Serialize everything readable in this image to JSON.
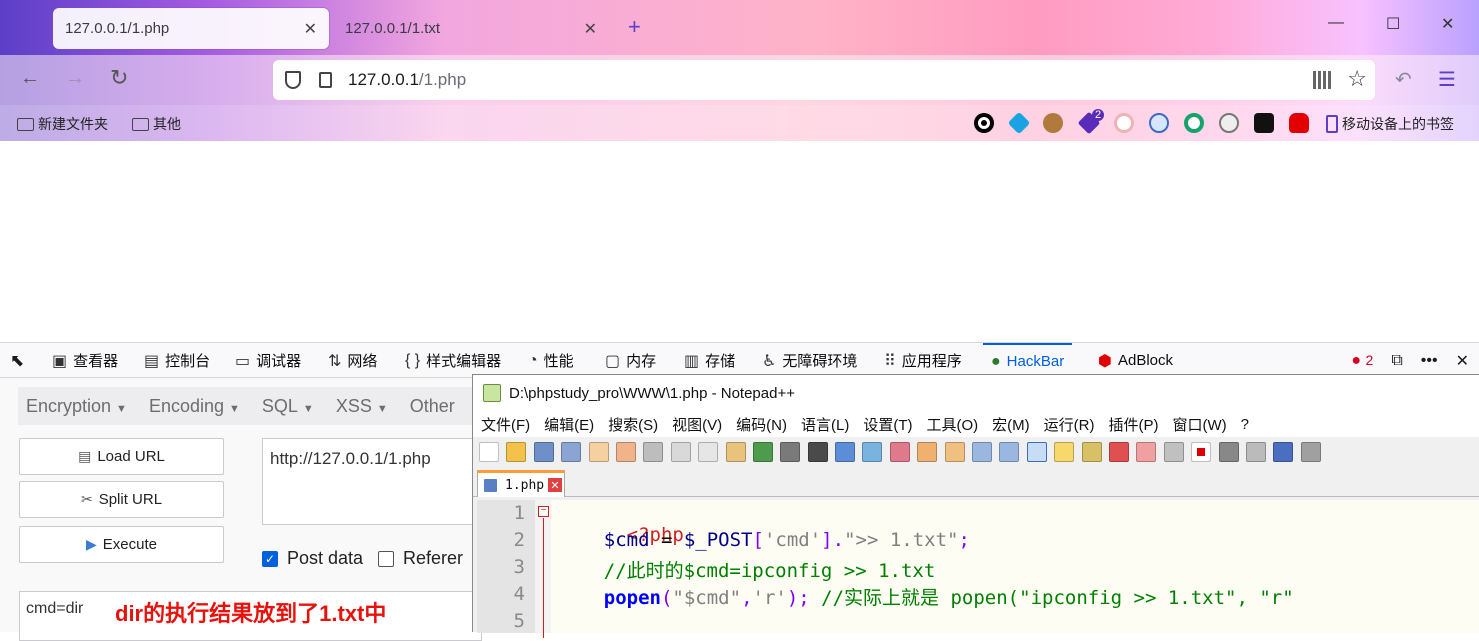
{
  "browser": {
    "tabs": [
      {
        "label": "127.0.0.1/1.php",
        "active": true
      },
      {
        "label": "127.0.0.1/1.txt",
        "active": false
      }
    ],
    "new_tab": "+",
    "window_controls": {
      "minimize": "—",
      "maximize": "☐",
      "close": "✕"
    },
    "url_host": "127.0.0.1",
    "url_path": "/1.php",
    "bookmarks": [
      "新建文件夹",
      "其他"
    ],
    "mobile_bookmarks": "移动设备上的书签",
    "extension_badge": "2"
  },
  "devtools": {
    "tabs": [
      {
        "icon": "inspector-icon",
        "label": "查看器"
      },
      {
        "icon": "console-icon",
        "label": "控制台"
      },
      {
        "icon": "debugger-icon",
        "label": "调试器"
      },
      {
        "icon": "network-icon",
        "label": "网络"
      },
      {
        "icon": "style-editor-icon",
        "label": "样式编辑器"
      },
      {
        "icon": "performance-icon",
        "label": "性能"
      },
      {
        "icon": "memory-icon",
        "label": "内存"
      },
      {
        "icon": "storage-icon",
        "label": "存储"
      },
      {
        "icon": "accessibility-icon",
        "label": "无障碍环境"
      },
      {
        "icon": "application-icon",
        "label": "应用程序"
      },
      {
        "icon": "hackbar-icon",
        "label": "HackBar"
      },
      {
        "icon": "adblock-icon",
        "label": "AdBlock"
      }
    ],
    "error_count": "2"
  },
  "hackbar": {
    "menu": [
      "Encryption",
      "Encoding",
      "SQL",
      "XSS",
      "Other"
    ],
    "buttons": {
      "load": "Load URL",
      "split": "Split URL",
      "execute": "Execute"
    },
    "url_value": "http://127.0.0.1/1.php",
    "post_data_label": "Post data",
    "post_data_checked": true,
    "referer_label": "Referer",
    "referer_checked": false,
    "post_body": "cmd=dir",
    "annotation": "dir的执行结果放到了1.txt中"
  },
  "notepad": {
    "title": "D:\\phpstudy_pro\\WWW\\1.php - Notepad++",
    "menu": [
      "文件(F)",
      "编辑(E)",
      "搜索(S)",
      "视图(V)",
      "编码(N)",
      "语言(L)",
      "设置(T)",
      "工具(O)",
      "宏(M)",
      "运行(R)",
      "插件(P)",
      "窗口(W)",
      "?"
    ],
    "file_tab": "1.php",
    "line_numbers": [
      "1",
      "2",
      "3",
      "4",
      "5"
    ],
    "code": {
      "l1": "<?php",
      "l2_indent": "    ",
      "l2_var": "$cmd",
      "l2_eq": " = ",
      "l2_post": "$_POST",
      "l2_b1": "[",
      "l2_key": "'cmd'",
      "l2_b2": "]",
      "l2_dot": ".",
      "l2_str": "\">> 1.txt\"",
      "l2_semi": ";",
      "l3": "    //此时的$cmd=ipconfig >> 1.txt",
      "l4_indent": "    ",
      "l4_fn": "popen",
      "l4_p1": "(",
      "l4_arg1": "\"$cmd\"",
      "l4_comma": ",",
      "l4_arg2": "'r'",
      "l4_p2": ");",
      "l4_cmt": " //实际上就是 popen(\"ipconfig >> 1.txt\", \"r\""
    }
  },
  "colors": {
    "hackbar_accent": "#0060df",
    "annotation": "#e8120c",
    "php_tag": "#d02020",
    "comment": "#008000"
  }
}
